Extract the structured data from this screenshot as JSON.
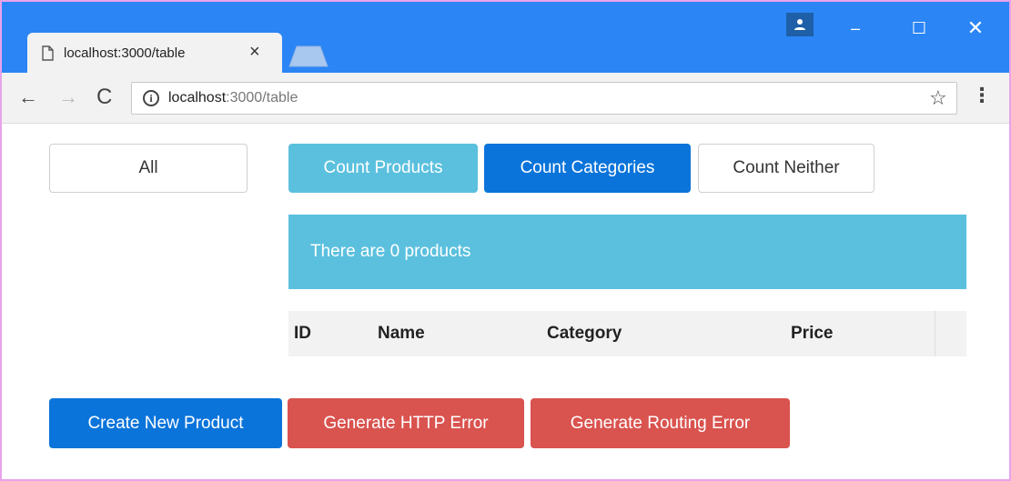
{
  "browser": {
    "tab_title": "localhost:3000/table",
    "tab_close": "×",
    "url_host": "localhost",
    "url_rest": ":3000/table",
    "window_controls": {
      "minimize": "–",
      "maximize": "☐",
      "close": "✕"
    },
    "nav": {
      "back": "←",
      "forward": "→",
      "reload": "C"
    },
    "info": "i",
    "star": "☆",
    "menu": "⋮"
  },
  "filters": {
    "all": "All"
  },
  "count_buttons": {
    "products": "Count Products",
    "categories": "Count Categories",
    "neither": "Count Neither"
  },
  "alert": {
    "text": "There are 0 products"
  },
  "table": {
    "columns": [
      "ID",
      "Name",
      "Category",
      "Price"
    ],
    "rows": []
  },
  "actions": {
    "create": "Create New Product",
    "http_error": "Generate HTTP Error",
    "routing_error": "Generate Routing Error"
  },
  "colors": {
    "titlebar": "#2b85f5",
    "info": "#5bc0de",
    "primary": "#0a74da",
    "danger": "#d9534f",
    "frame": "#e8a3ea"
  }
}
